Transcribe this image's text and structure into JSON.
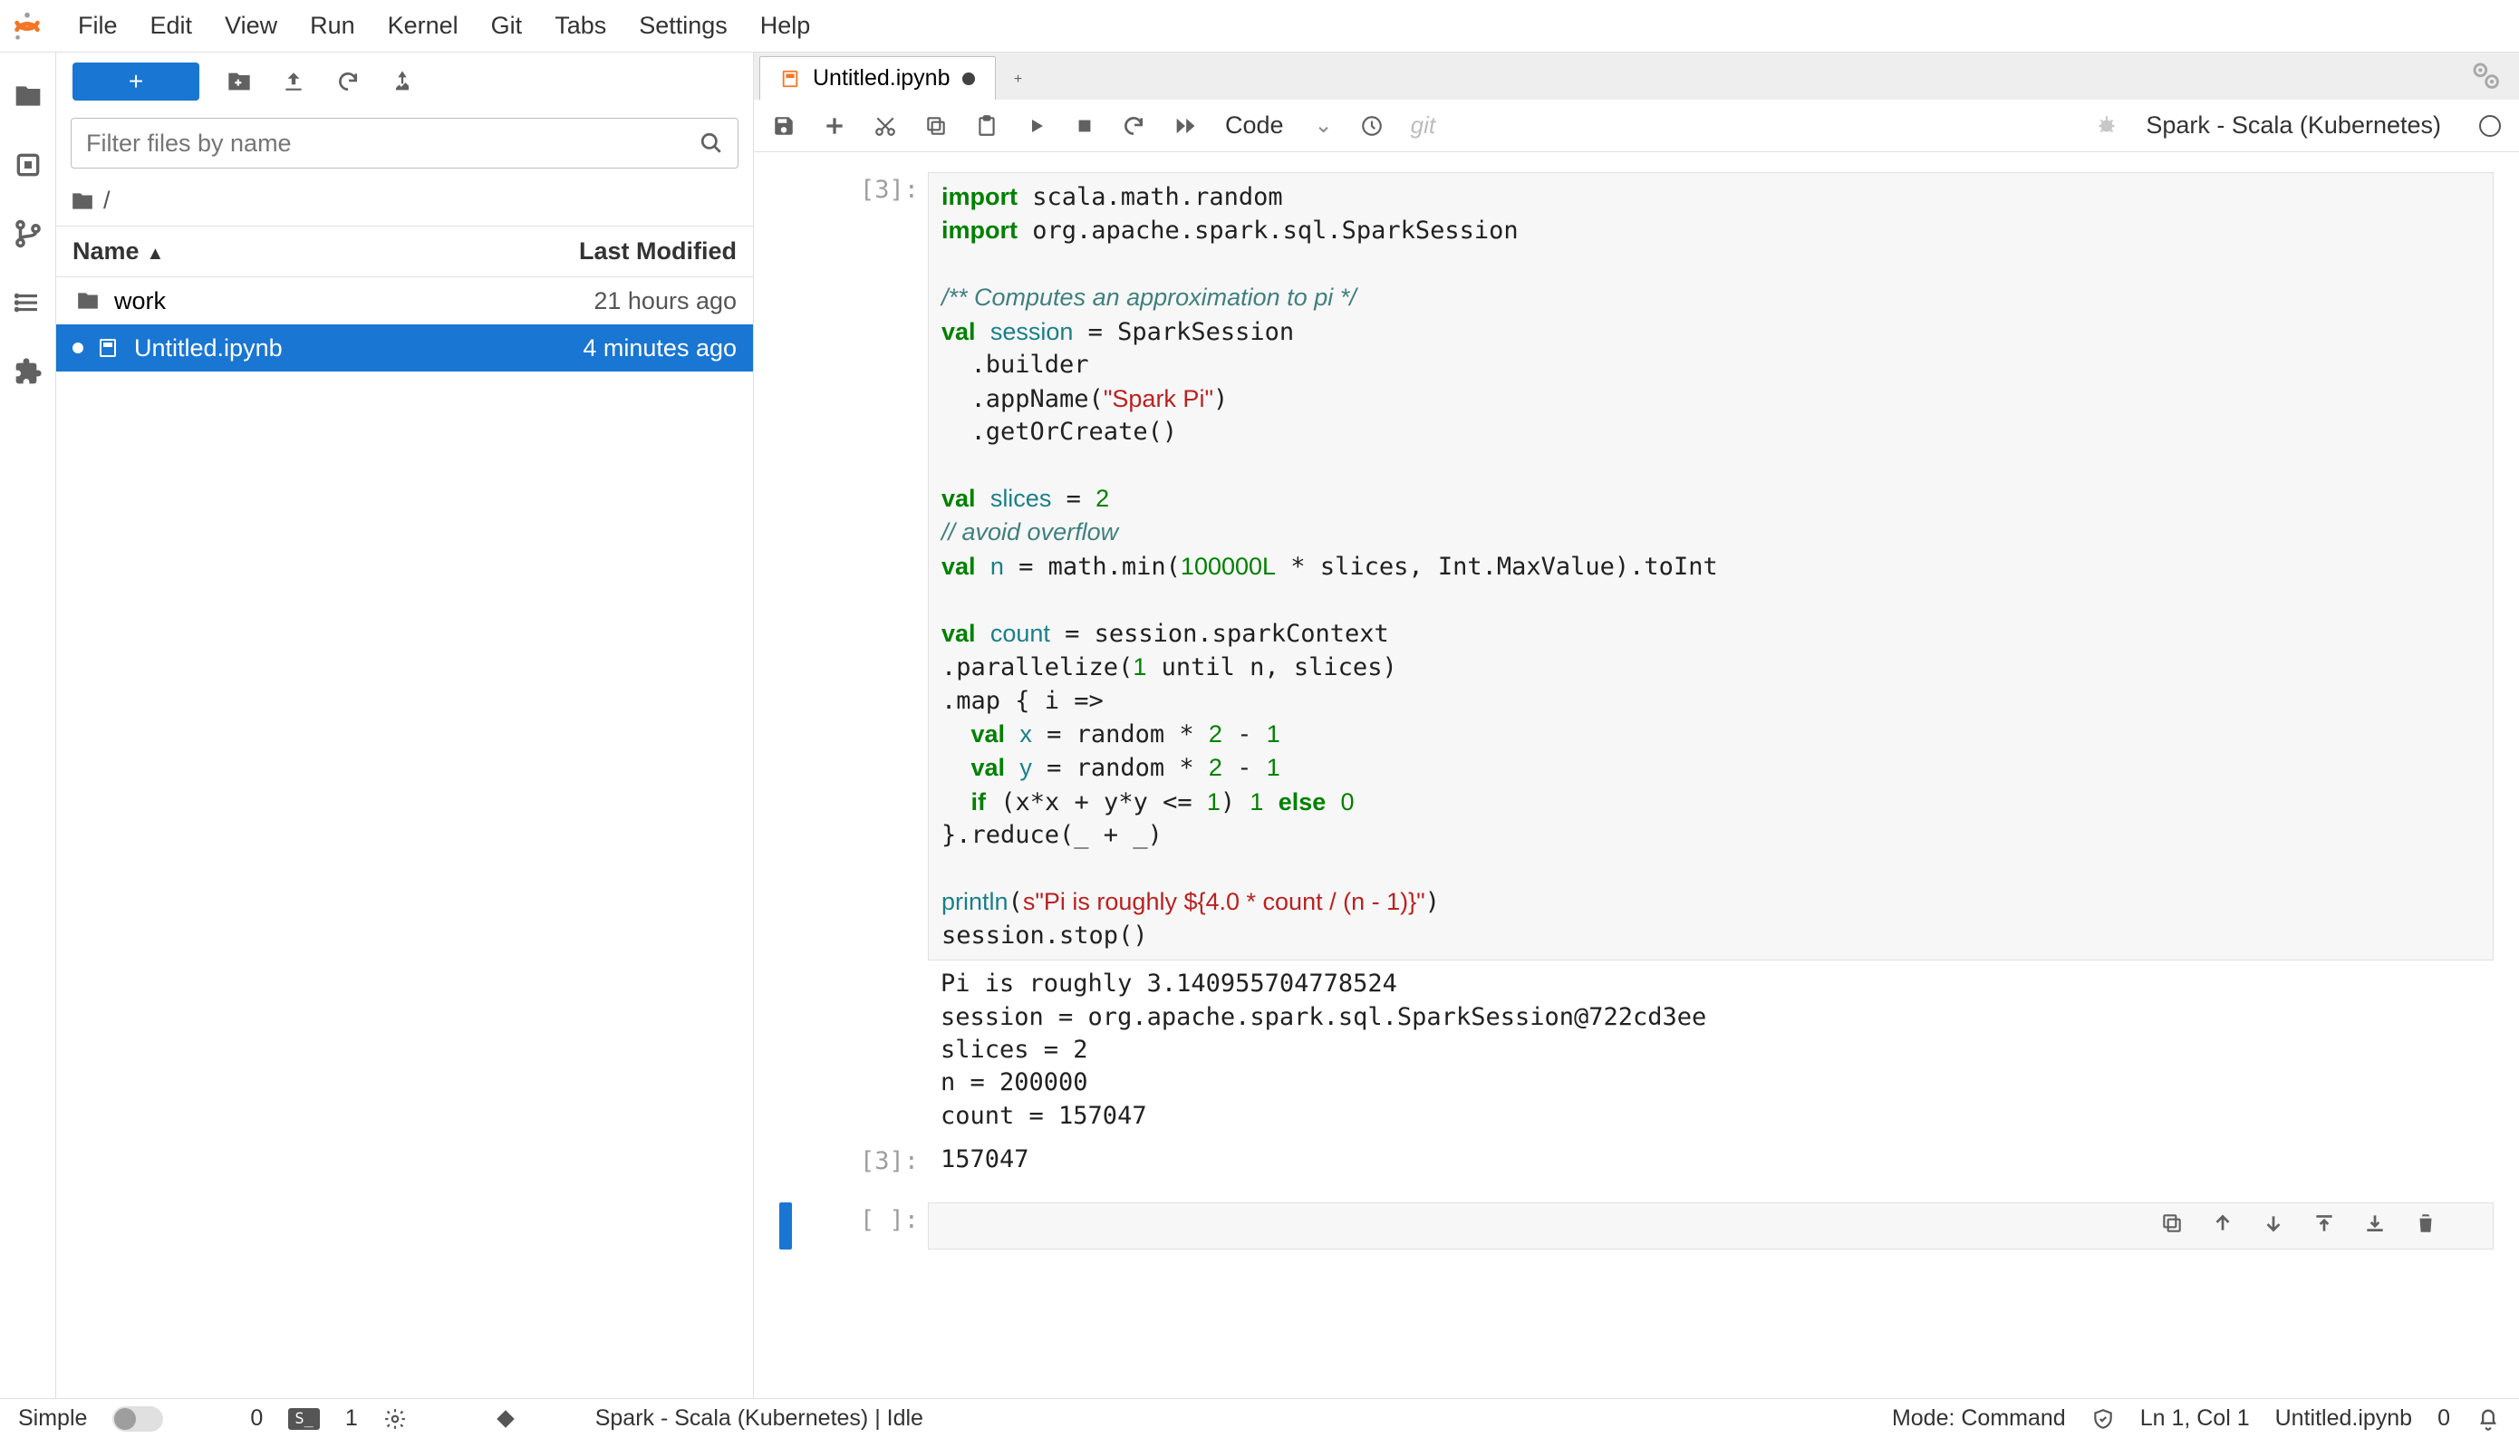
{
  "menubar": {
    "items": [
      "File",
      "Edit",
      "View",
      "Run",
      "Kernel",
      "Git",
      "Tabs",
      "Settings",
      "Help"
    ]
  },
  "filepanel": {
    "filter_placeholder": "Filter files by name",
    "breadcrumb": "/",
    "header": {
      "name": "Name",
      "modified": "Last Modified"
    },
    "rows": [
      {
        "type": "folder",
        "name": "work",
        "modified": "21 hours ago",
        "selected": false,
        "running": false
      },
      {
        "type": "notebook",
        "name": "Untitled.ipynb",
        "modified": "4 minutes ago",
        "selected": true,
        "running": true
      }
    ]
  },
  "tab": {
    "title": "Untitled.ipynb"
  },
  "nbtoolbar": {
    "celltype": "Code",
    "git": "git",
    "kernel": "Spark - Scala (Kubernetes)"
  },
  "cells": {
    "exec3": {
      "prompt": "[3]:",
      "out_prompt": "[3]:",
      "result": "157047",
      "output": "Pi is roughly 3.140955704778524\nsession = org.apache.spark.sql.SparkSession@722cd3ee\nslices = 2\nn = 200000\ncount = 157047"
    },
    "empty": {
      "prompt": "[ ]:"
    }
  },
  "status": {
    "simple": "Simple",
    "zero": "0",
    "badge": "S_",
    "one": "1",
    "kernel": "Spark - Scala (Kubernetes) | Idle",
    "mode": "Mode: Command",
    "ln": "Ln 1, Col 1",
    "file": "Untitled.ipynb",
    "zero2": "0"
  }
}
